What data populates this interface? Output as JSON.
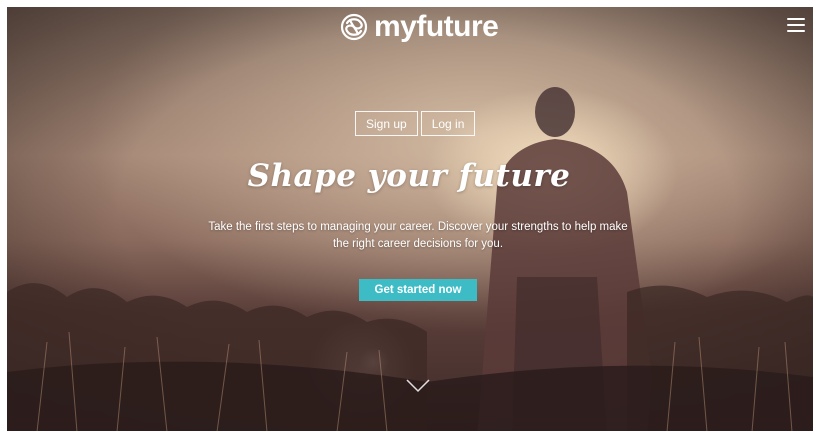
{
  "header": {
    "logo_text": "myfuture",
    "logo_icon": "brain-knot-icon",
    "menu_icon": "hamburger-menu-icon"
  },
  "auth": {
    "signup_label": "Sign up",
    "login_label": "Log in"
  },
  "hero": {
    "title": "Shape your future",
    "subtitle": "Take the first steps to managing your career. Discover your strengths to help make the right career decisions for you.",
    "cta_label": "Get started now",
    "scroll_icon": "chevron-down-icon"
  },
  "colors": {
    "accent": "#3dbcc6",
    "text": "#ffffff"
  }
}
